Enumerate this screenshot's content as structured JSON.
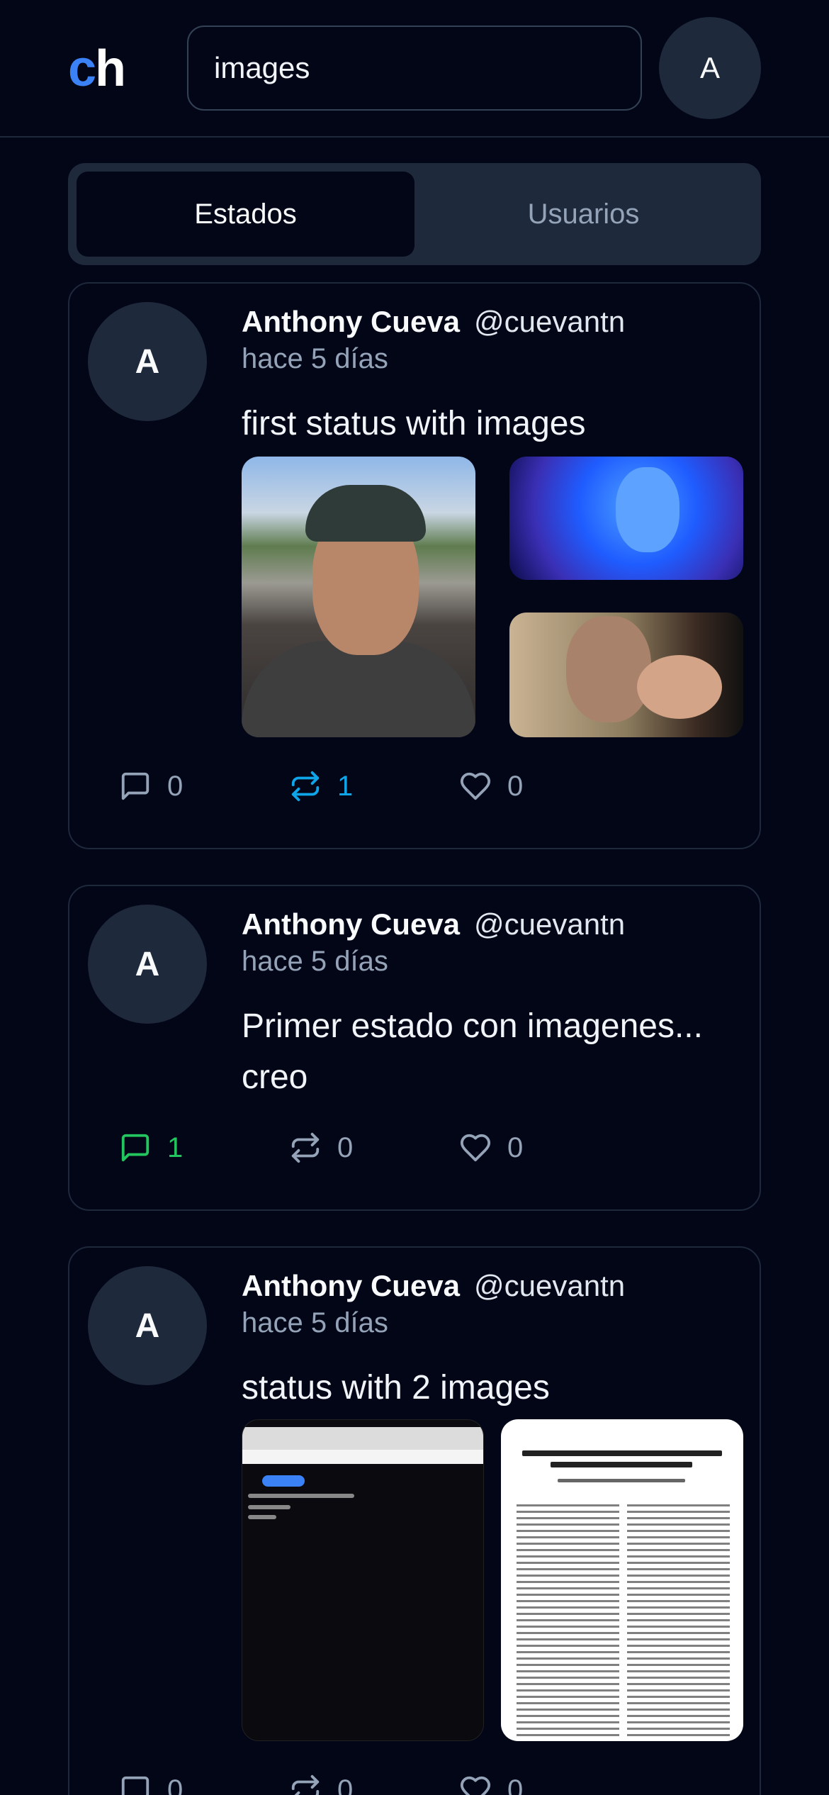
{
  "header": {
    "logo_c": "c",
    "logo_h": "h",
    "search_value": "images",
    "avatar_initial": "A"
  },
  "tabs": [
    {
      "label": "Estados",
      "active": true
    },
    {
      "label": "Usuarios",
      "active": false
    }
  ],
  "posts": [
    {
      "avatar_initial": "A",
      "name": "Anthony Cueva",
      "handle": "@cuevantn",
      "time": "hace 5 días",
      "text": "first status with images",
      "comments": "0",
      "reposts": "1",
      "likes": "0"
    },
    {
      "avatar_initial": "A",
      "name": "Anthony Cueva",
      "handle": "@cuevantn",
      "time": "hace 5 días",
      "text": "Primer estado con imagenes... creo",
      "comments": "1",
      "reposts": "0",
      "likes": "0"
    },
    {
      "avatar_initial": "A",
      "name": "Anthony Cueva",
      "handle": "@cuevantn",
      "time": "hace 5 días",
      "text": "status with 2 images",
      "comments": "0",
      "reposts": "0",
      "likes": "0"
    }
  ],
  "colors": {
    "accent": "#3b82f6",
    "repost_active": "#0ea5e9",
    "comment_active": "#22c55e",
    "muted": "#94a3b8",
    "background": "#020617",
    "surface": "#1e293b"
  },
  "icons": {
    "comment": "message-square-icon",
    "repost": "repeat-icon",
    "like": "heart-icon"
  }
}
